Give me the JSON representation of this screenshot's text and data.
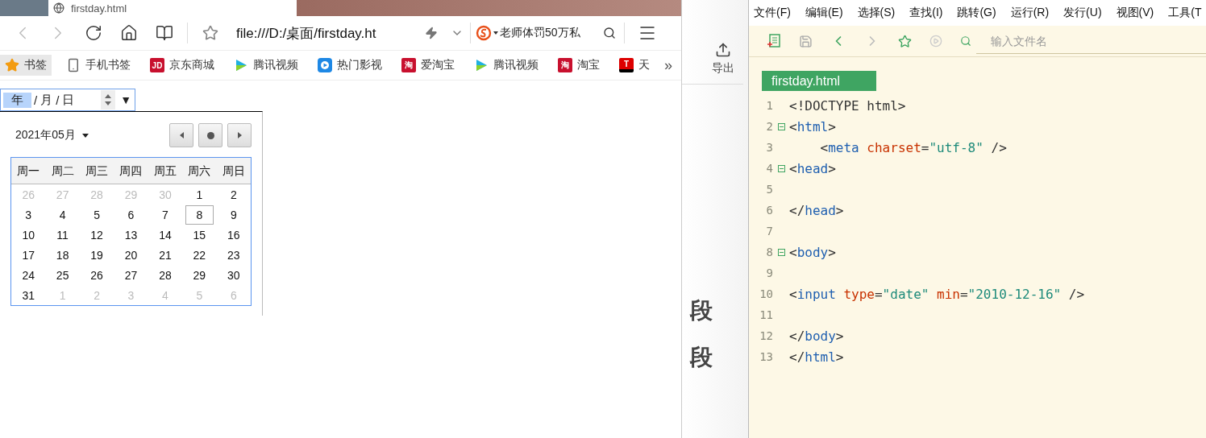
{
  "browser": {
    "tab": {
      "title": "firstday.html"
    },
    "address": "file:///D:/桌面/firstday.ht",
    "search": "老师体罚50万私",
    "bookmarks": [
      {
        "kind": "star",
        "label": "书签",
        "selected": true
      },
      {
        "kind": "phone",
        "label": "手机书签",
        "selected": false
      },
      {
        "kind": "letter",
        "badge": "JD",
        "label": "京东商城",
        "selected": false
      },
      {
        "kind": "video",
        "label": "腾讯视频",
        "selected": false
      },
      {
        "kind": "hot",
        "label": "热门影视",
        "selected": false
      },
      {
        "kind": "letter",
        "badge": "淘",
        "label": "爱淘宝",
        "selected": false
      },
      {
        "kind": "video",
        "label": "腾讯视频",
        "selected": false
      },
      {
        "kind": "letter",
        "badge": "淘",
        "label": "淘宝",
        "selected": false
      },
      {
        "kind": "tletter",
        "badge": "T",
        "label": "天",
        "selected": false
      }
    ],
    "more": "»",
    "date_input": {
      "parts": [
        {
          "text": "年",
          "selected": true
        },
        {
          "text": "/",
          "selected": false
        },
        {
          "text": "月",
          "selected": false
        },
        {
          "text": "/",
          "selected": false
        },
        {
          "text": "日",
          "selected": false
        }
      ],
      "dropdown": "▼"
    },
    "calendar": {
      "month": "2021年05月",
      "weekdays": [
        "周一",
        "周二",
        "周三",
        "周四",
        "周五",
        "周六",
        "周日"
      ],
      "weeks": [
        [
          {
            "day": "26",
            "outside": true,
            "selected": false
          },
          {
            "day": "27",
            "outside": true,
            "selected": false
          },
          {
            "day": "28",
            "outside": true,
            "selected": false
          },
          {
            "day": "29",
            "outside": true,
            "selected": false
          },
          {
            "day": "30",
            "outside": true,
            "selected": false
          },
          {
            "day": "1",
            "outside": false,
            "selected": false
          },
          {
            "day": "2",
            "outside": false,
            "selected": false
          }
        ],
        [
          {
            "day": "3",
            "outside": false,
            "selected": false
          },
          {
            "day": "4",
            "outside": false,
            "selected": false
          },
          {
            "day": "5",
            "outside": false,
            "selected": false
          },
          {
            "day": "6",
            "outside": false,
            "selected": false
          },
          {
            "day": "7",
            "outside": false,
            "selected": false
          },
          {
            "day": "8",
            "outside": false,
            "selected": true
          },
          {
            "day": "9",
            "outside": false,
            "selected": false
          }
        ],
        [
          {
            "day": "10",
            "outside": false,
            "selected": false
          },
          {
            "day": "11",
            "outside": false,
            "selected": false
          },
          {
            "day": "12",
            "outside": false,
            "selected": false
          },
          {
            "day": "13",
            "outside": false,
            "selected": false
          },
          {
            "day": "14",
            "outside": false,
            "selected": false
          },
          {
            "day": "15",
            "outside": false,
            "selected": false
          },
          {
            "day": "16",
            "outside": false,
            "selected": false
          }
        ],
        [
          {
            "day": "17",
            "outside": false,
            "selected": false
          },
          {
            "day": "18",
            "outside": false,
            "selected": false
          },
          {
            "day": "19",
            "outside": false,
            "selected": false
          },
          {
            "day": "20",
            "outside": false,
            "selected": false
          },
          {
            "day": "21",
            "outside": false,
            "selected": false
          },
          {
            "day": "22",
            "outside": false,
            "selected": false
          },
          {
            "day": "23",
            "outside": false,
            "selected": false
          }
        ],
        [
          {
            "day": "24",
            "outside": false,
            "selected": false
          },
          {
            "day": "25",
            "outside": false,
            "selected": false
          },
          {
            "day": "26",
            "outside": false,
            "selected": false
          },
          {
            "day": "27",
            "outside": false,
            "selected": false
          },
          {
            "day": "28",
            "outside": false,
            "selected": false
          },
          {
            "day": "29",
            "outside": false,
            "selected": false
          },
          {
            "day": "30",
            "outside": false,
            "selected": false
          }
        ],
        [
          {
            "day": "31",
            "outside": false,
            "selected": false
          },
          {
            "day": "1",
            "outside": true,
            "selected": false
          },
          {
            "day": "2",
            "outside": true,
            "selected": false
          },
          {
            "day": "3",
            "outside": true,
            "selected": false
          },
          {
            "day": "4",
            "outside": true,
            "selected": false
          },
          {
            "day": "5",
            "outside": true,
            "selected": false
          },
          {
            "day": "6",
            "outside": true,
            "selected": false
          }
        ]
      ]
    }
  },
  "middle_panel": {
    "export_label": "导出",
    "fragments": [
      "段",
      "段"
    ]
  },
  "editor": {
    "menu": [
      "文件(F)",
      "编辑(E)",
      "选择(S)",
      "查找(I)",
      "跳转(G)",
      "运行(R)",
      "发行(U)",
      "视图(V)",
      "工具(T"
    ],
    "file_search": {
      "placeholder": "输入文件名"
    },
    "file_tab": "firstday.html",
    "lines": [
      {
        "number": "1",
        "fold": false,
        "tokens": [
          {
            "kind": "punct",
            "text": "<!DOCTYPE html>"
          }
        ]
      },
      {
        "number": "2",
        "fold": true,
        "tokens": [
          {
            "kind": "punct",
            "text": "<"
          },
          {
            "kind": "tag",
            "text": "html"
          },
          {
            "kind": "punct",
            "text": ">"
          }
        ]
      },
      {
        "number": "3",
        "fold": false,
        "tokens": [
          {
            "kind": "punct",
            "text": "    <"
          },
          {
            "kind": "tag",
            "text": "meta "
          },
          {
            "kind": "attr",
            "text": "charset"
          },
          {
            "kind": "punct",
            "text": "="
          },
          {
            "kind": "string",
            "text": "\"utf-8\""
          },
          {
            "kind": "punct",
            "text": " />"
          }
        ]
      },
      {
        "number": "4",
        "fold": true,
        "tokens": [
          {
            "kind": "punct",
            "text": "<"
          },
          {
            "kind": "tag",
            "text": "head"
          },
          {
            "kind": "punct",
            "text": ">"
          }
        ]
      },
      {
        "number": "5",
        "fold": false
      },
      {
        "number": "6",
        "fold": false,
        "tokens": [
          {
            "kind": "punct",
            "text": "</"
          },
          {
            "kind": "tag",
            "text": "head"
          },
          {
            "kind": "punct",
            "text": ">"
          }
        ]
      },
      {
        "number": "7",
        "fold": false
      },
      {
        "number": "8",
        "fold": true,
        "tokens": [
          {
            "kind": "punct",
            "text": "<"
          },
          {
            "kind": "tag",
            "text": "body"
          },
          {
            "kind": "punct",
            "text": ">"
          }
        ]
      },
      {
        "number": "9",
        "fold": false
      },
      {
        "number": "10",
        "fold": false,
        "tokens": [
          {
            "kind": "punct",
            "text": "<"
          },
          {
            "kind": "tag",
            "text": "input "
          },
          {
            "kind": "attr",
            "text": "type"
          },
          {
            "kind": "punct",
            "text": "="
          },
          {
            "kind": "string",
            "text": "\"date\" "
          },
          {
            "kind": "attr",
            "text": "min"
          },
          {
            "kind": "punct",
            "text": "="
          },
          {
            "kind": "string",
            "text": "\"2010-12-16\""
          },
          {
            "kind": "punct",
            "text": " />"
          }
        ]
      },
      {
        "number": "11",
        "fold": false
      },
      {
        "number": "12",
        "fold": false,
        "tokens": [
          {
            "kind": "punct",
            "text": "</"
          },
          {
            "kind": "tag",
            "text": "body"
          },
          {
            "kind": "punct",
            "text": ">"
          }
        ]
      },
      {
        "number": "13",
        "fold": false,
        "tokens": [
          {
            "kind": "punct",
            "text": "</"
          },
          {
            "kind": "tag",
            "text": "html"
          },
          {
            "kind": "punct",
            "text": ">"
          }
        ]
      }
    ]
  }
}
